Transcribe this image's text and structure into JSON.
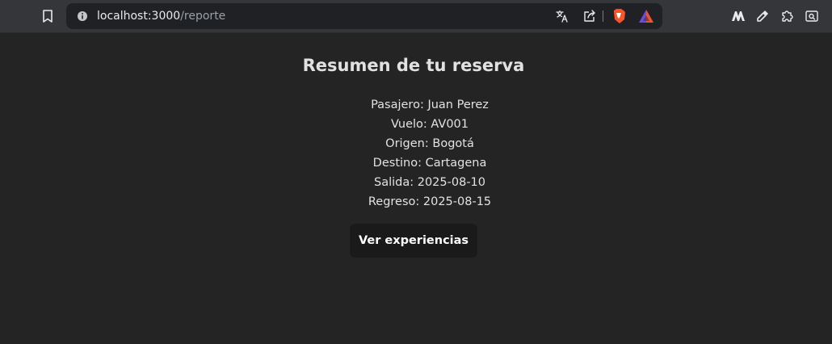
{
  "browser": {
    "url_host": "localhost:3000",
    "url_path": "/reporte",
    "icons": [
      "bookmark-icon",
      "site-info-icon",
      "translate-icon",
      "share-icon",
      "brave-shields-icon",
      "brave-rewards-icon",
      "extension-m-icon",
      "color-picker-icon",
      "extensions-puzzle-icon",
      "screenshot-icon"
    ]
  },
  "page": {
    "title": "Resumen de tu reserva",
    "details": [
      "Pasajero: Juan Perez",
      "Vuelo: AV001",
      "Origen: Bogotá",
      "Destino: Cartagena",
      "Salida: 2025-08-10",
      "Regreso: 2025-08-15"
    ],
    "button_label": "Ver experiencias"
  },
  "colors": {
    "background": "#242424",
    "toolbar": "#35363a",
    "omnibox": "#202124",
    "button": "#1a1a1a",
    "text": "#e2e2e2"
  }
}
